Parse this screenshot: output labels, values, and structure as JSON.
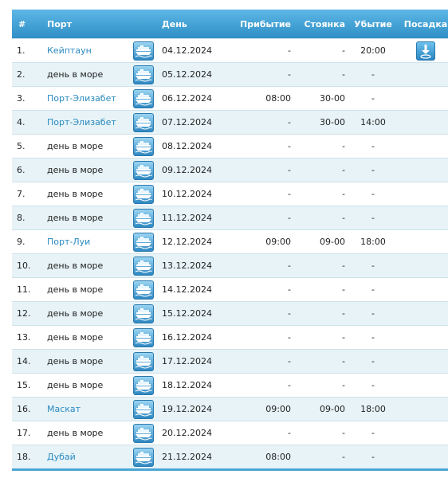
{
  "header": {
    "num": "#",
    "port": "Порт",
    "day": "День",
    "arrival": "Прибытие",
    "stay": "Стоянка",
    "departure": "Убытие",
    "boarding": "Посадка"
  },
  "rows": [
    {
      "num": "1.",
      "port": "Кейптаун",
      "port_link": true,
      "day": "04.12.2024",
      "arrival": "-",
      "stay": "-",
      "departure": "20:00",
      "boarding": true
    },
    {
      "num": "2.",
      "port": "день в море",
      "port_link": false,
      "day": "05.12.2024",
      "arrival": "-",
      "stay": "-",
      "departure": "-",
      "boarding": false
    },
    {
      "num": "3.",
      "port": "Порт-Элизабет",
      "port_link": true,
      "day": "06.12.2024",
      "arrival": "08:00",
      "stay": "30-00",
      "departure": "-",
      "boarding": false
    },
    {
      "num": "4.",
      "port": "Порт-Элизабет",
      "port_link": true,
      "day": "07.12.2024",
      "arrival": "-",
      "stay": "30-00",
      "departure": "14:00",
      "boarding": false
    },
    {
      "num": "5.",
      "port": "день в море",
      "port_link": false,
      "day": "08.12.2024",
      "arrival": "-",
      "stay": "-",
      "departure": "-",
      "boarding": false
    },
    {
      "num": "6.",
      "port": "день в море",
      "port_link": false,
      "day": "09.12.2024",
      "arrival": "-",
      "stay": "-",
      "departure": "-",
      "boarding": false
    },
    {
      "num": "7.",
      "port": "день в море",
      "port_link": false,
      "day": "10.12.2024",
      "arrival": "-",
      "stay": "-",
      "departure": "-",
      "boarding": false
    },
    {
      "num": "8.",
      "port": "день в море",
      "port_link": false,
      "day": "11.12.2024",
      "arrival": "-",
      "stay": "-",
      "departure": "-",
      "boarding": false
    },
    {
      "num": "9.",
      "port": "Порт-Луи",
      "port_link": true,
      "day": "12.12.2024",
      "arrival": "09:00",
      "stay": "09-00",
      "departure": "18:00",
      "boarding": false
    },
    {
      "num": "10.",
      "port": "день в море",
      "port_link": false,
      "day": "13.12.2024",
      "arrival": "-",
      "stay": "-",
      "departure": "-",
      "boarding": false
    },
    {
      "num": "11.",
      "port": "день в море",
      "port_link": false,
      "day": "14.12.2024",
      "arrival": "-",
      "stay": "-",
      "departure": "-",
      "boarding": false
    },
    {
      "num": "12.",
      "port": "день в море",
      "port_link": false,
      "day": "15.12.2024",
      "arrival": "-",
      "stay": "-",
      "departure": "-",
      "boarding": false
    },
    {
      "num": "13.",
      "port": "день в море",
      "port_link": false,
      "day": "16.12.2024",
      "arrival": "-",
      "stay": "-",
      "departure": "-",
      "boarding": false
    },
    {
      "num": "14.",
      "port": "день в море",
      "port_link": false,
      "day": "17.12.2024",
      "arrival": "-",
      "stay": "-",
      "departure": "-",
      "boarding": false
    },
    {
      "num": "15.",
      "port": "день в море",
      "port_link": false,
      "day": "18.12.2024",
      "arrival": "-",
      "stay": "-",
      "departure": "-",
      "boarding": false
    },
    {
      "num": "16.",
      "port": "Маскат",
      "port_link": true,
      "day": "19.12.2024",
      "arrival": "09:00",
      "stay": "09-00",
      "departure": "18:00",
      "boarding": false
    },
    {
      "num": "17.",
      "port": "день в море",
      "port_link": false,
      "day": "20.12.2024",
      "arrival": "-",
      "stay": "-",
      "departure": "-",
      "boarding": false
    },
    {
      "num": "18.",
      "port": "Дубай",
      "port_link": true,
      "day": "21.12.2024",
      "arrival": "08:00",
      "stay": "-",
      "departure": "-",
      "boarding": false
    }
  ],
  "icons": {
    "ship": "ship-icon",
    "boarding": "boarding-icon"
  },
  "colors": {
    "header": "#3d9fd3",
    "link": "#2a8ac0",
    "row_alt": "#e7f3f7"
  }
}
